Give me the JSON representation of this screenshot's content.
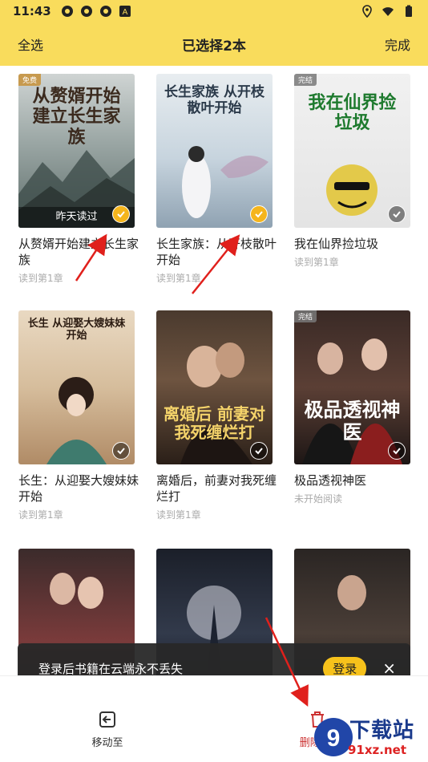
{
  "status": {
    "time": "11:43",
    "left_icons": [
      "app-icon",
      "app-icon",
      "app-icon",
      "font-a-icon"
    ],
    "right_icons": [
      "location-icon",
      "wifi-icon",
      "battery-icon"
    ]
  },
  "header": {
    "select_all": "全选",
    "title": "已选择2本",
    "done": "完成"
  },
  "books": [
    {
      "cover_title": "从赘婿开始建立长生家族",
      "cover_sub": "",
      "tag": "免费",
      "last_read": "昨天读过",
      "title": "从赘婿开始建立长生家族",
      "progress": "读到第1章",
      "selected": true
    },
    {
      "cover_title": "长生家族 从开枝散叶开始",
      "cover_sub": "",
      "tag": "",
      "last_read": "",
      "title": "长生家族：从开枝散叶开始",
      "progress": "读到第1章",
      "selected": true
    },
    {
      "cover_title": "我在仙界捡垃圾",
      "cover_sub": "",
      "tag": "完结",
      "last_read": "",
      "title": "我在仙界捡垃圾",
      "progress": "读到第1章",
      "selected": false
    },
    {
      "cover_title": "长生 从迎娶大嫂妹妹开始",
      "cover_sub": "",
      "tag": "",
      "last_read": "",
      "title": "长生：从迎娶大嫂妹妹开始",
      "progress": "读到第1章",
      "selected": false
    },
    {
      "cover_title": "离婚后 前妻对我死缠烂打",
      "cover_sub": "",
      "tag": "",
      "last_read": "",
      "title": "离婚后，前妻对我死缠烂打",
      "progress": "读到第1章",
      "selected": false
    },
    {
      "cover_title": "极品透视神医",
      "cover_sub": "",
      "tag": "完结",
      "last_read": "",
      "title": "极品透视神医",
      "progress": "未开始阅读",
      "selected": false
    },
    {
      "cover_title": "",
      "cover_sub": "",
      "tag": "",
      "last_read": "",
      "title": "",
      "progress": "",
      "selected": false
    },
    {
      "cover_title": "",
      "cover_sub": "",
      "tag": "",
      "last_read": "",
      "title": "",
      "progress": "",
      "selected": false
    },
    {
      "cover_title": "",
      "cover_sub": "",
      "tag": "",
      "last_read": "",
      "title": "",
      "progress": "",
      "selected": false
    }
  ],
  "toast": {
    "text": "登录后书籍在云端永不丢失",
    "login": "登录",
    "close": "×"
  },
  "bottom": {
    "move": "移动至",
    "delete": "删除(2)"
  },
  "watermark": {
    "text": "下载站",
    "url": "91xz.net"
  },
  "colors": {
    "accent": "#f9dc5c",
    "check_on": "#f5b51c",
    "arrow": "#e0201c"
  }
}
